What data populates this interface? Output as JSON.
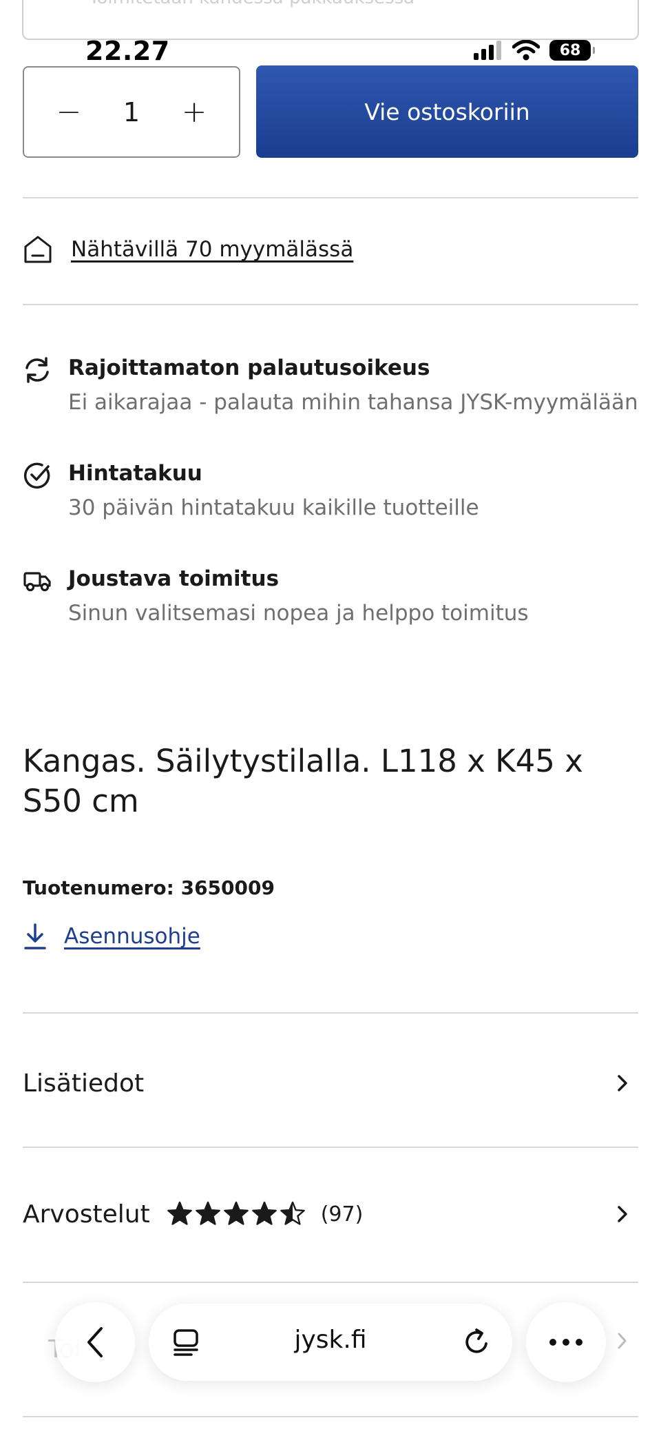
{
  "status_bar": {
    "time": "22.27",
    "battery": "68"
  },
  "top_box": {
    "text": "Toimitetaan kahdessa pakkauksessa"
  },
  "purchase": {
    "quantity": "1",
    "decrease_symbol": "−",
    "increase_symbol": "+",
    "add_to_cart_label": "Vie ostoskoriin"
  },
  "store": {
    "availability_label": "Nähtävillä 70 myymälässä",
    "icon": "store-icon"
  },
  "benefits": [
    {
      "icon": "return-arrows-icon",
      "title": "Rajoittamaton palautusoikeus",
      "description": "Ei aikarajaa - palauta mihin tahansa JYSK-myymälään"
    },
    {
      "icon": "check-circle-icon",
      "title": "Hintatakuu",
      "description": "30 päivän hintatakuu kaikille tuotteille"
    },
    {
      "icon": "truck-icon",
      "title": "Joustava toimitus",
      "description": "Sinun valitsemasi nopea ja helppo toimitus"
    }
  ],
  "product": {
    "description": "Kangas. Säilytystilalla. L118 x K45 x S50 cm",
    "product_number": "Tuotenumero: 3650009",
    "manual_link": "Asennusohje"
  },
  "accordion": {
    "details_label": "Lisätiedot",
    "reviews_label": "Arvostelut",
    "rating": 4.5,
    "rating_max": 5,
    "review_count": "(97)",
    "faded_label": "Toi"
  },
  "browser": {
    "url": "jysk.fi"
  },
  "colors": {
    "primary_blue": "#1e3f8f",
    "text_gray": "#6f6f6f",
    "divider": "#d8d8d8"
  }
}
